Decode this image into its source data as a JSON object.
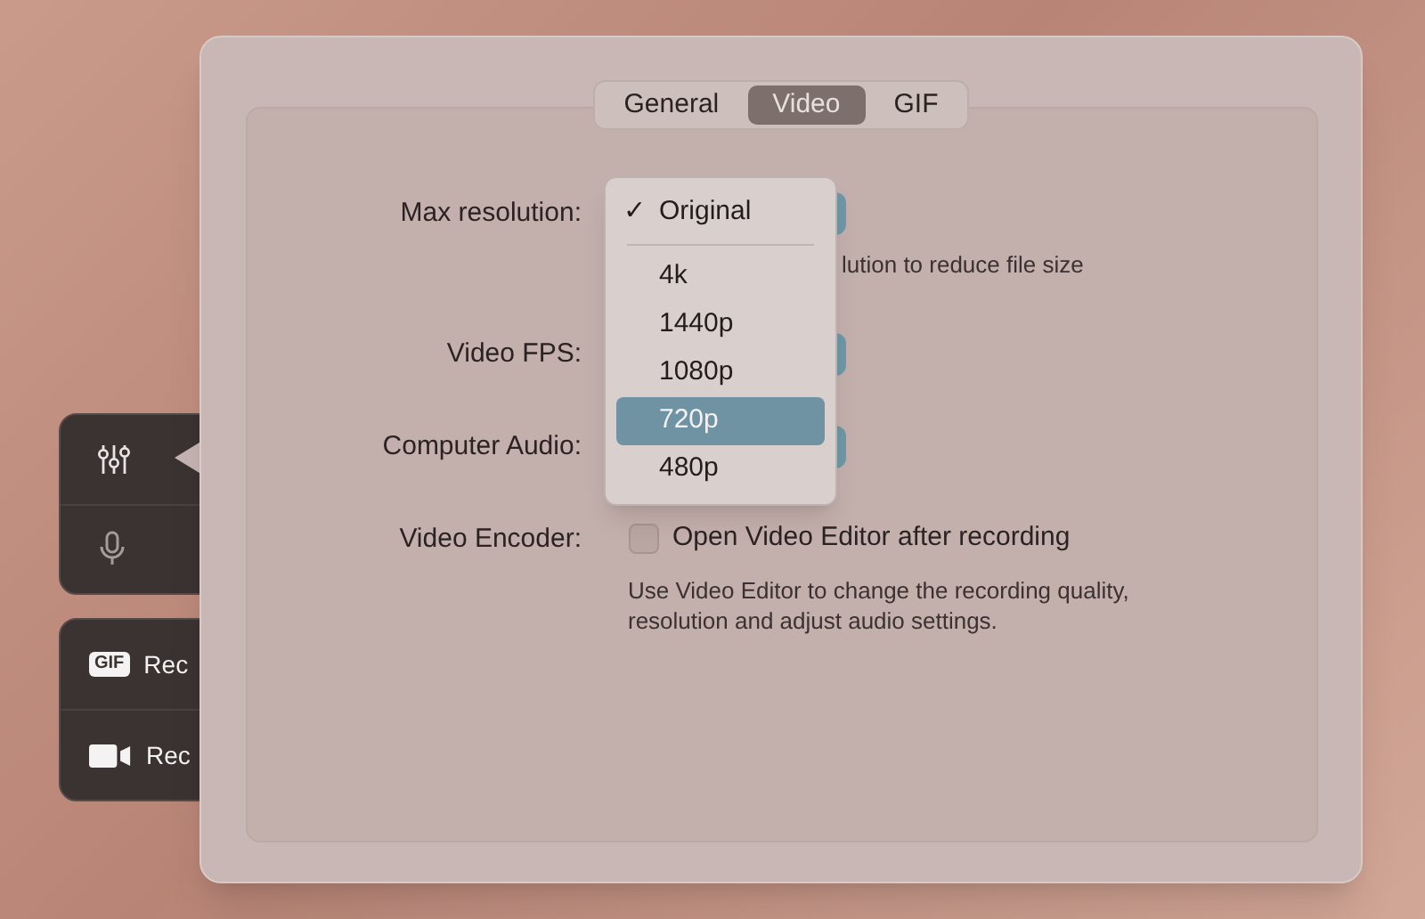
{
  "side_panel": {
    "tools": [
      {
        "kind": "mixer"
      },
      {
        "kind": "mic"
      }
    ],
    "actions": [
      {
        "kind": "gif",
        "badge": "GIF",
        "label": "Rec"
      },
      {
        "kind": "camera",
        "label": "Rec"
      }
    ]
  },
  "window": {
    "tabs": [
      {
        "label": "General",
        "selected": false
      },
      {
        "label": "Video",
        "selected": true
      },
      {
        "label": "GIF",
        "selected": false
      }
    ],
    "form": [
      {
        "kind": "popup",
        "label": "Max resolution:",
        "hint": "lution to reduce file size"
      },
      {
        "kind": "popup",
        "label": "Video FPS:"
      },
      {
        "kind": "popup",
        "label": "Computer Audio:"
      },
      {
        "kind": "checkbox",
        "label": "Video Encoder:",
        "option": "Open Video Editor after recording",
        "checked": false,
        "description": "Use Video Editor to change the recording quality, resolution and adjust audio settings."
      }
    ],
    "menu": {
      "check_mark": "✓",
      "items": [
        {
          "label": "Original",
          "checked": true,
          "selected": false
        },
        {
          "label": "4k",
          "checked": false,
          "selected": false
        },
        {
          "label": "1440p",
          "checked": false,
          "selected": false
        },
        {
          "label": "1080p",
          "checked": false,
          "selected": false
        },
        {
          "label": "720p",
          "checked": false,
          "selected": true
        },
        {
          "label": "480p",
          "checked": false,
          "selected": false
        }
      ]
    }
  }
}
